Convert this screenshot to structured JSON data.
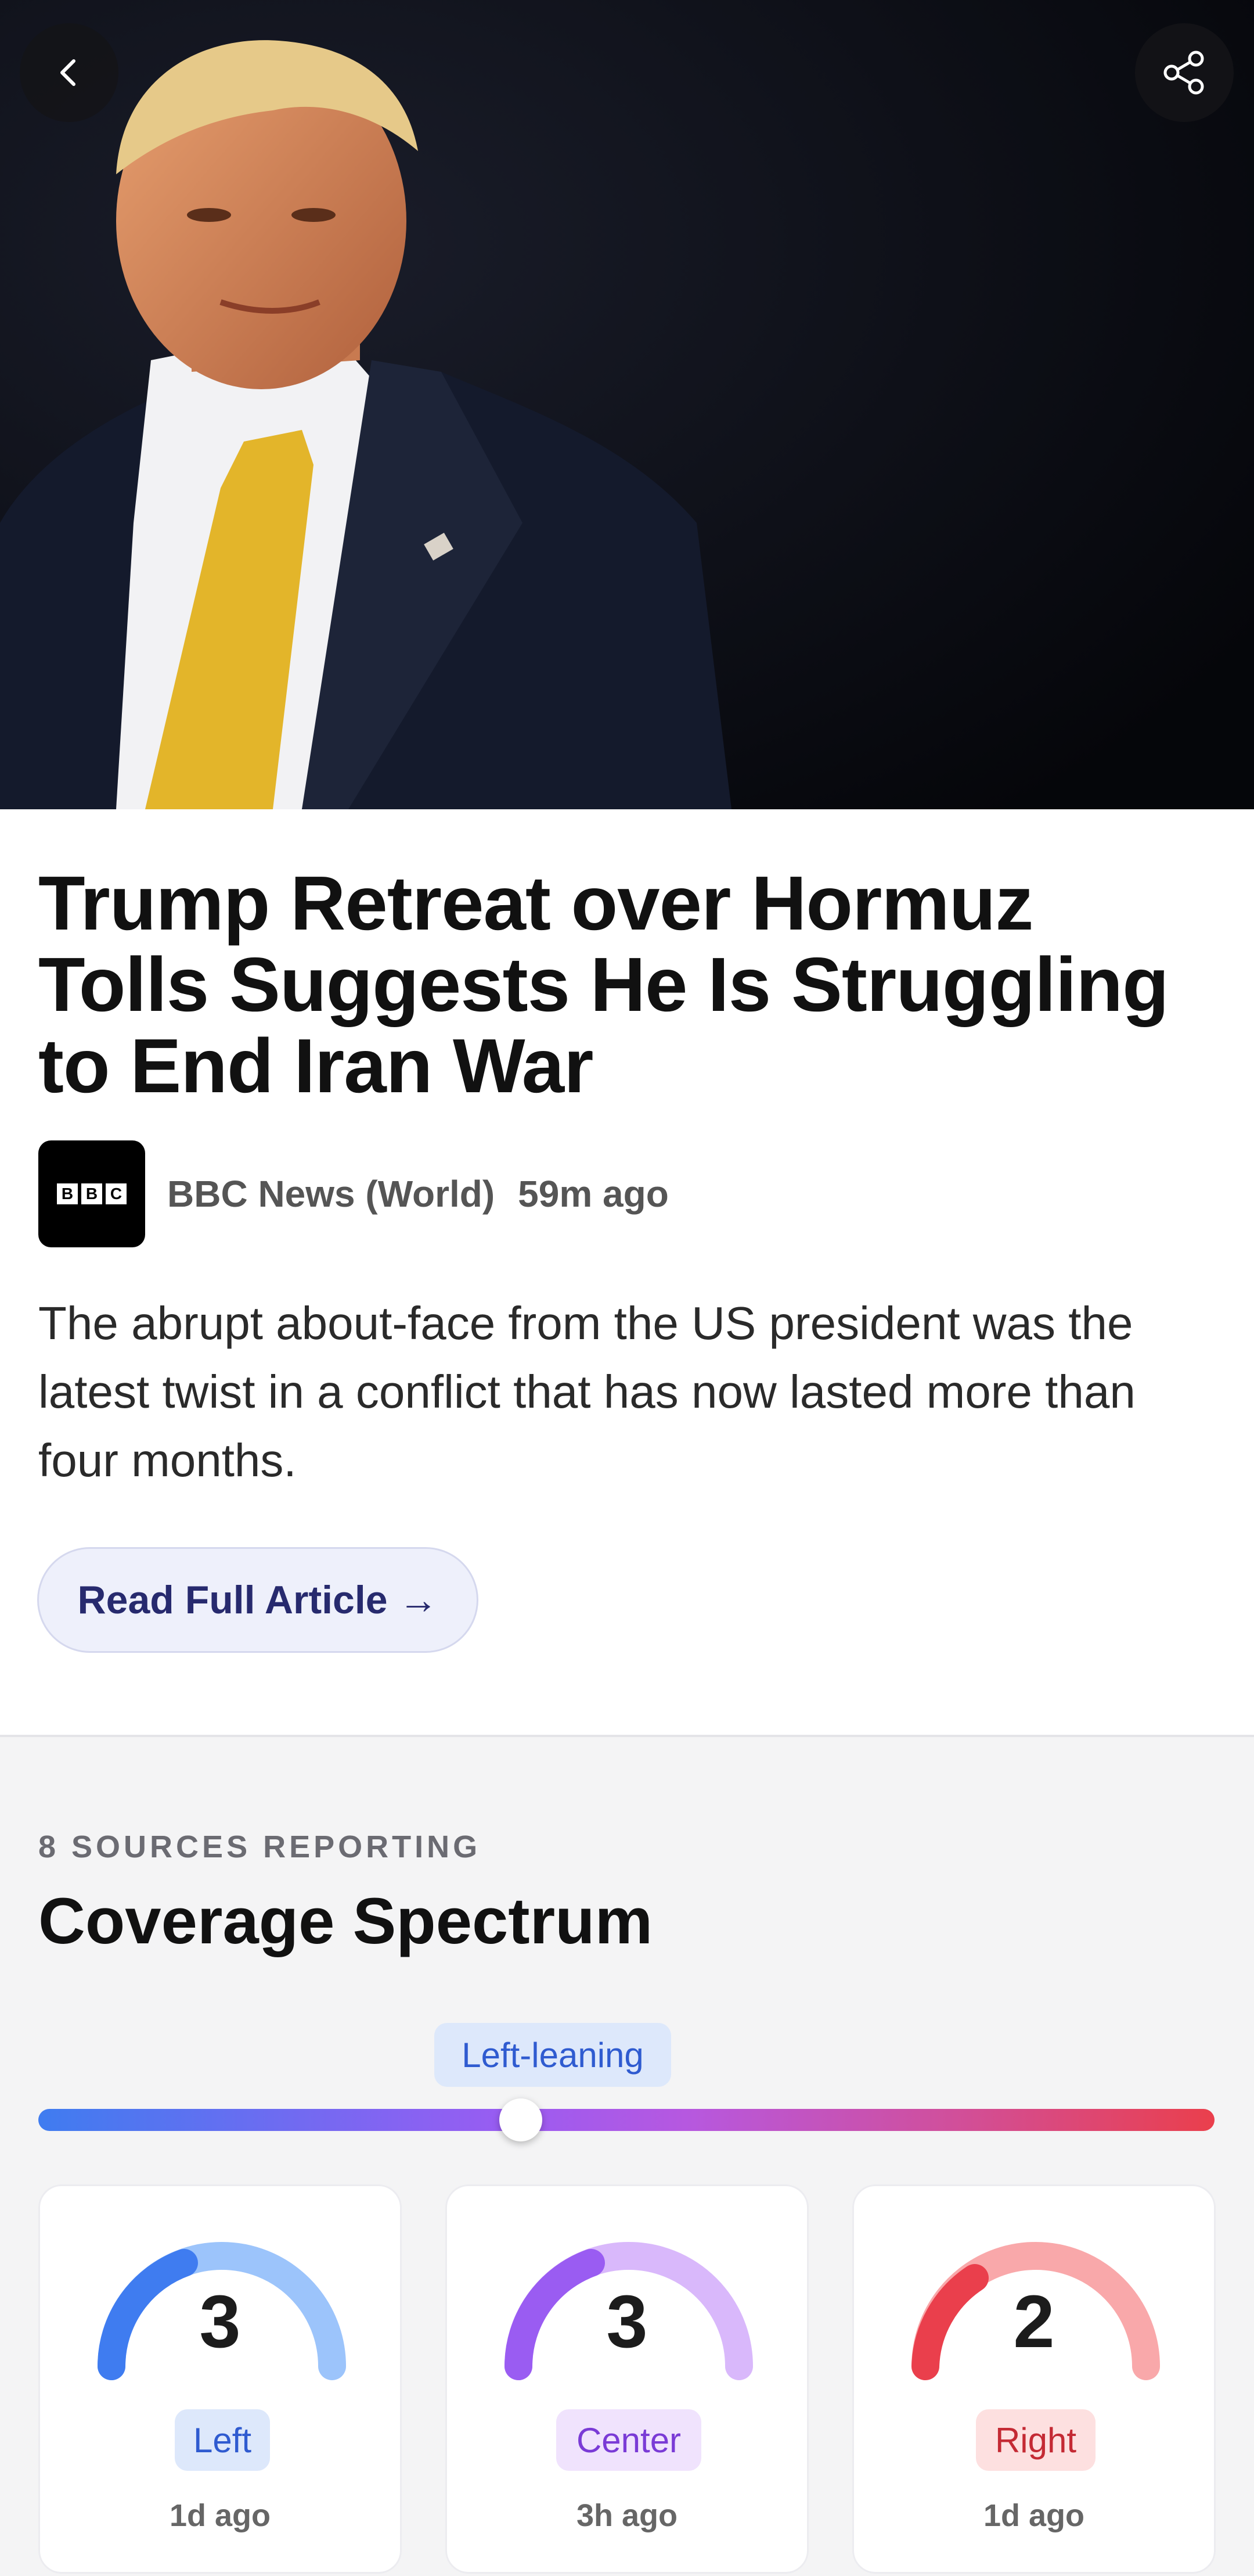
{
  "hero": {
    "image_description": "Portrait photo of Donald Trump in dark suit with yellow tie",
    "back_icon": "chevron-left-icon",
    "share_icon": "share-icon"
  },
  "article": {
    "headline": "Trump Retreat over Hormuz Tolls Suggests He Is Struggling to End Iran War",
    "source_name": "BBC News (World)",
    "time_ago": "59m ago",
    "logo_letters": [
      "B",
      "B",
      "C"
    ],
    "summary": "The abrupt about-face from the US president was the latest twist in a conflict that has now lasted more than four months.",
    "read_button": "Read Full Article →"
  },
  "coverage": {
    "kicker": "8 SOURCES REPORTING",
    "title": "Coverage Spectrum",
    "lean_label": "Left-leaning",
    "lean_position": 0.41,
    "cards": [
      {
        "count": "3",
        "label": "Left",
        "age": "1d ago",
        "color": "#3f7cf0",
        "light": "#9cc4fb",
        "tag_bg": "#dde8fb",
        "tag_fg": "#2f5bd0"
      },
      {
        "count": "3",
        "label": "Center",
        "age": "3h ago",
        "color": "#9a5cf2",
        "light": "#d9b8fb",
        "tag_bg": "#f0e3fd",
        "tag_fg": "#7a3bd6"
      },
      {
        "count": "2",
        "label": "Right",
        "age": "1d ago",
        "color": "#ea3f4c",
        "light": "#f9a8aa",
        "tag_bg": "#fde0e0",
        "tag_fg": "#c42a34"
      }
    ]
  }
}
